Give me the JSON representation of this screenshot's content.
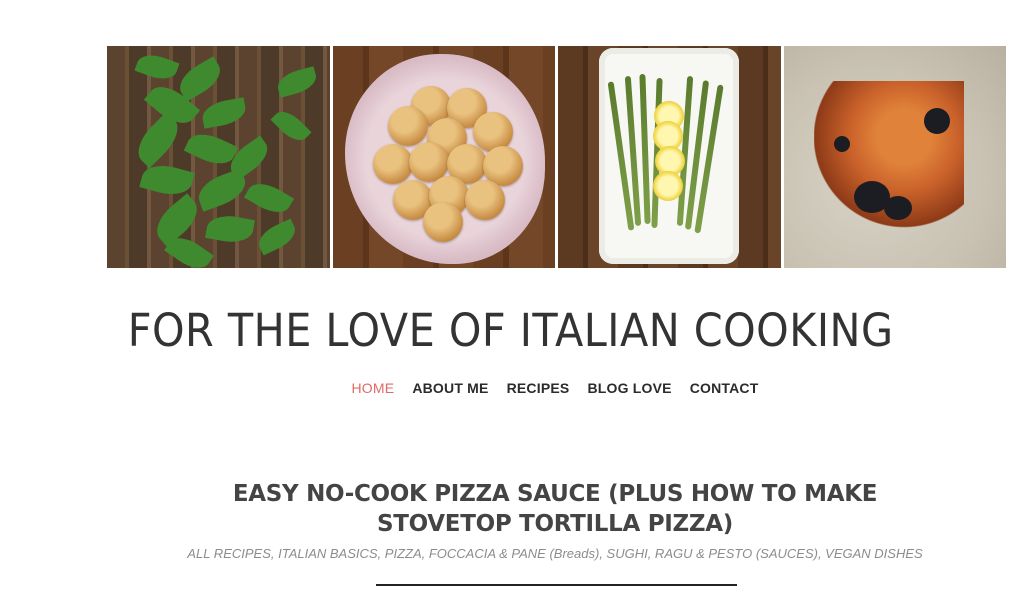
{
  "header": {
    "banner_images": [
      "basil",
      "bread-rolls",
      "asparagus-with-lemon",
      "pastry"
    ],
    "site_title": "FOR THE LOVE OF ITALIAN COOKING"
  },
  "nav": {
    "items": [
      {
        "label": "HOME",
        "active": true
      },
      {
        "label": "ABOUT ME",
        "active": false
      },
      {
        "label": "RECIPES",
        "active": false
      },
      {
        "label": "BLOG LOVE",
        "active": false
      },
      {
        "label": "CONTACT",
        "active": false
      }
    ]
  },
  "post": {
    "title": "EASY NO-COOK PIZZA SAUCE (PLUS HOW TO MAKE STOVETOP TORTILLA PIZZA)",
    "categories": "ALL RECIPES, ITALIAN BASICS, PIZZA, FOCCACIA & PANE (Breads), SUGHI, RAGU & PESTO (SAUCES), VEGAN DISHES"
  },
  "colors": {
    "accent": "#e06a66",
    "text": "#333333",
    "muted": "#8c8c8c"
  }
}
